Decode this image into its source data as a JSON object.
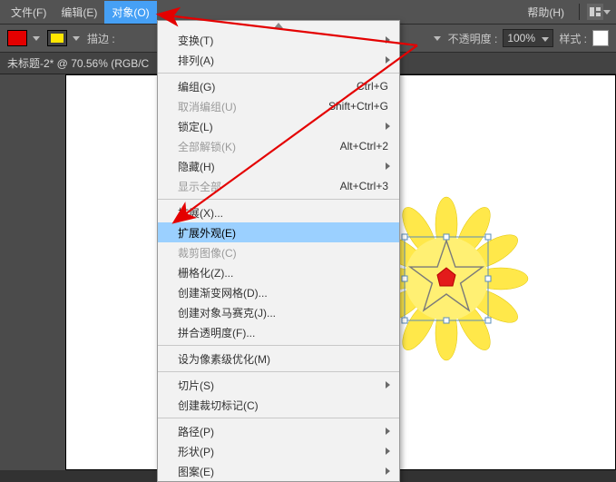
{
  "menubar": {
    "file": "文件(F)",
    "edit": "编辑(E)",
    "object": "对象(O)",
    "help": "帮助(H)"
  },
  "toolbar": {
    "stroke_label": "描边 :",
    "opacity_label": "不透明度 :",
    "opacity_value": "100%",
    "style_label": "样式 :"
  },
  "doc_tab": "未标题-2* @ 70.56% (RGB/C",
  "dropdown": {
    "items": [
      {
        "label": "变换(T)",
        "submenu": true
      },
      {
        "label": "排列(A)",
        "submenu": true
      },
      {
        "sep": true
      },
      {
        "label": "编组(G)",
        "shortcut": "Ctrl+G"
      },
      {
        "label": "取消编组(U)",
        "shortcut": "Shift+Ctrl+G",
        "disabled": true
      },
      {
        "label": "锁定(L)",
        "submenu": true
      },
      {
        "label": "全部解锁(K)",
        "shortcut": "Alt+Ctrl+2",
        "disabled": true
      },
      {
        "label": "隐藏(H)",
        "submenu": true
      },
      {
        "label": "显示全部",
        "shortcut": "Alt+Ctrl+3",
        "disabled": true
      },
      {
        "sep": true
      },
      {
        "label": "扩展(X)..."
      },
      {
        "label": "扩展外观(E)",
        "highlight": true
      },
      {
        "label": "裁剪图像(C)",
        "disabled": true
      },
      {
        "label": "栅格化(Z)..."
      },
      {
        "label": "创建渐变网格(D)..."
      },
      {
        "label": "创建对象马赛克(J)..."
      },
      {
        "label": "拼合透明度(F)..."
      },
      {
        "sep": true
      },
      {
        "label": "设为像素级优化(M)"
      },
      {
        "sep": true
      },
      {
        "label": "切片(S)",
        "submenu": true
      },
      {
        "label": "创建裁切标记(C)"
      },
      {
        "sep": true
      },
      {
        "label": "路径(P)",
        "submenu": true
      },
      {
        "label": "形状(P)",
        "submenu": true
      },
      {
        "label": "图案(E)",
        "submenu": true
      }
    ]
  }
}
